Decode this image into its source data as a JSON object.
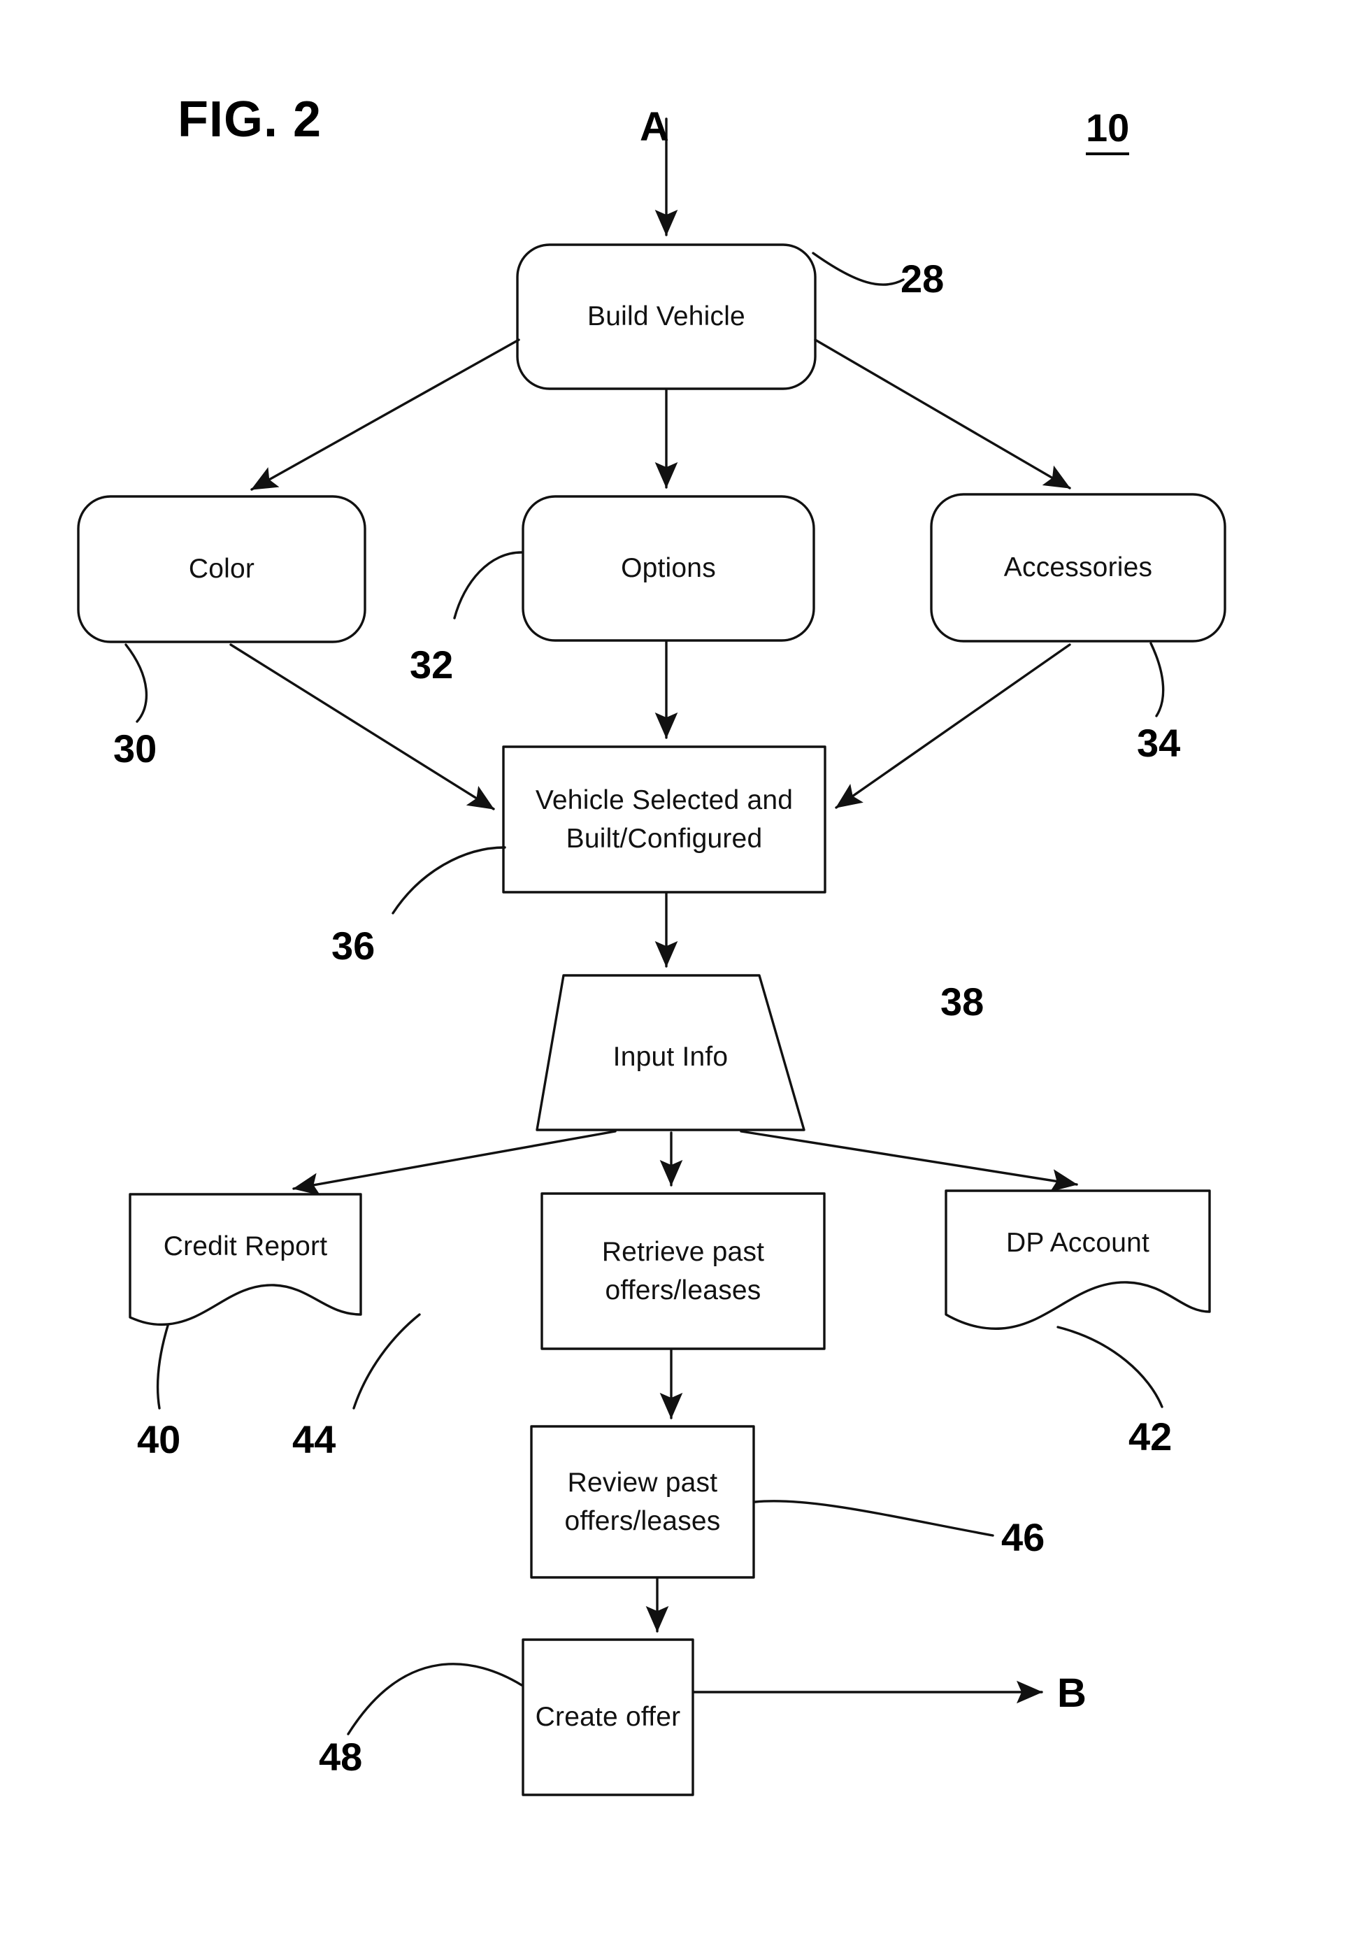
{
  "figure": {
    "title": "FIG. 2",
    "system_number": "10"
  },
  "connectors": {
    "entry": "A",
    "exit": "B"
  },
  "nodes": {
    "build_vehicle": {
      "label": "Build Vehicle",
      "ref": "28",
      "shape": "rounded-rectangle"
    },
    "color": {
      "label": "Color",
      "ref": "30",
      "shape": "rounded-rectangle"
    },
    "options": {
      "label": "Options",
      "ref": "32",
      "shape": "rounded-rectangle"
    },
    "accessories": {
      "label": "Accessories",
      "ref": "34",
      "shape": "rounded-rectangle"
    },
    "vehicle_selected": {
      "label": "Vehicle Selected and\nBuilt/Configured",
      "ref": "36",
      "shape": "rectangle"
    },
    "input_info": {
      "label": "Input Info",
      "ref": "38",
      "shape": "trapezoid"
    },
    "credit_report": {
      "label": "Credit Report",
      "ref": "40",
      "shape": "document"
    },
    "retrieve_past": {
      "label": "Retrieve past\noffers/leases",
      "ref": "44",
      "shape": "rectangle"
    },
    "dp_account": {
      "label": "DP Account",
      "ref": "42",
      "shape": "document"
    },
    "review_past": {
      "label": "Review past\noffers/leases",
      "ref": "46",
      "shape": "rectangle"
    },
    "create_offer": {
      "label": "Create offer",
      "ref": "48",
      "shape": "rectangle"
    }
  },
  "reference_labels": {
    "n28": "28",
    "n30": "30",
    "n32": "32",
    "n34": "34",
    "n36": "36",
    "n38": "38",
    "n40": "40",
    "n42": "42",
    "n44": "44",
    "n46": "46",
    "n48": "48"
  },
  "colors": {
    "ink": "#111111",
    "background": "#ffffff"
  }
}
